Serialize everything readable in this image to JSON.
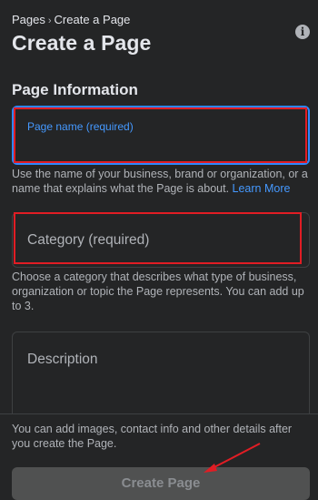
{
  "breadcrumb": {
    "parent": "Pages",
    "separator": "›",
    "current": "Create a Page"
  },
  "header": {
    "title": "Create a Page",
    "info_icon": "info-icon"
  },
  "section": {
    "title": "Page Information"
  },
  "page_name": {
    "placeholder": "Page name (required)",
    "value": "",
    "helper": "Use the name of your business, brand or organization, or a name that explains what the Page is about.",
    "helper_link": "Learn More"
  },
  "category": {
    "placeholder": "Category (required)",
    "helper": "Choose a category that describes what type of business, organization or topic the Page represents. You can add up to 3."
  },
  "description": {
    "placeholder": "Description"
  },
  "footer": {
    "note": "You can add images, contact info and other details after you create the Page.",
    "create_button": "Create Page"
  },
  "colors": {
    "background": "#242526",
    "text": "#e4e6eb",
    "secondary_text": "#b0b3b8",
    "link": "#4599ff",
    "focus_border": "#2d88ff",
    "highlight": "#e11d24",
    "disabled_button": "#505151"
  }
}
